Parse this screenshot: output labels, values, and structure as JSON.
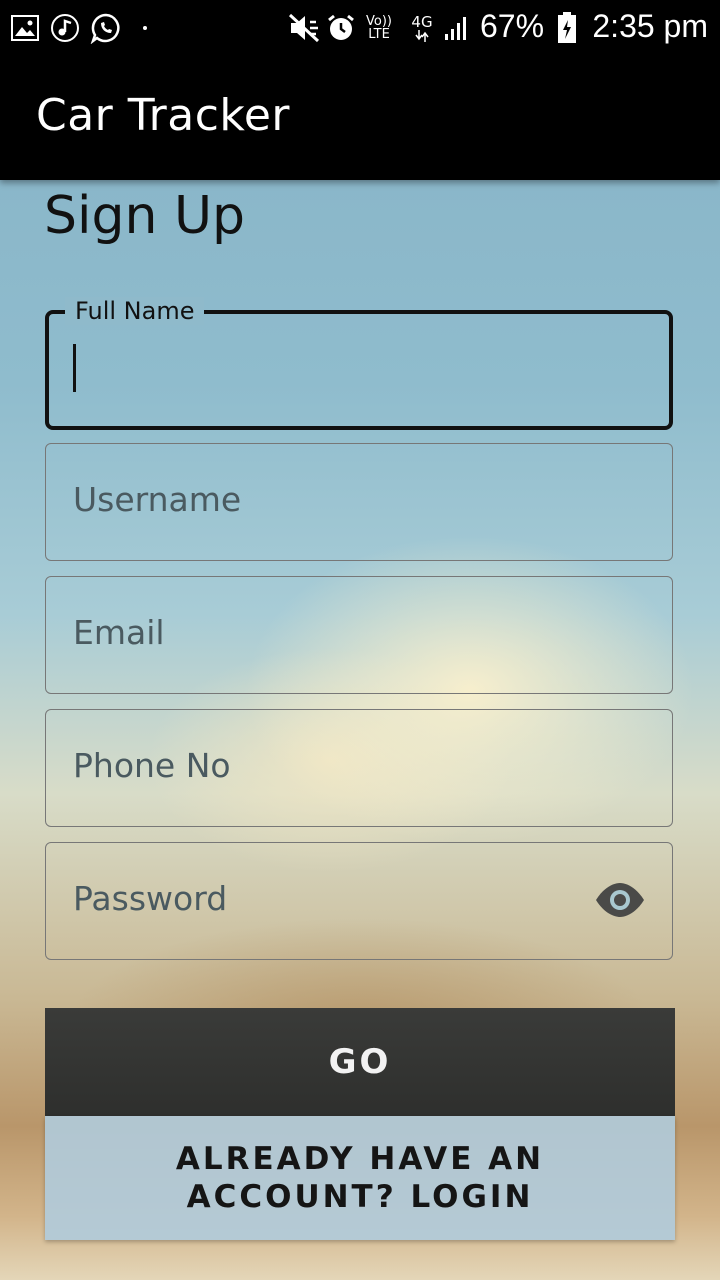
{
  "status_bar": {
    "battery_percent": "67%",
    "time": "2:35 pm",
    "network_label": "4G",
    "volte_label": "Vo)) LTE",
    "icons": [
      "gallery-icon",
      "music-icon",
      "whatsapp-icon",
      "dot-icon",
      "mute-icon",
      "alarm-icon",
      "volte-icon",
      "4g-icon",
      "signal-icon",
      "battery-icon"
    ]
  },
  "app_bar": {
    "title": "Car Tracker"
  },
  "form": {
    "heading": "Sign Up",
    "full_name_label": "Full Name",
    "full_name_value": "",
    "username_placeholder": "Username",
    "email_placeholder": "Email",
    "phone_placeholder": "Phone No",
    "password_placeholder": "Password",
    "password_toggle_icon": "eye-icon"
  },
  "buttons": {
    "go_label": "GO",
    "login_label": "ALREADY HAVE AN ACCOUNT? LOGIN"
  },
  "colors": {
    "app_bar": "#000000",
    "go_button": "#333432",
    "login_button": "#b0cbdc"
  }
}
